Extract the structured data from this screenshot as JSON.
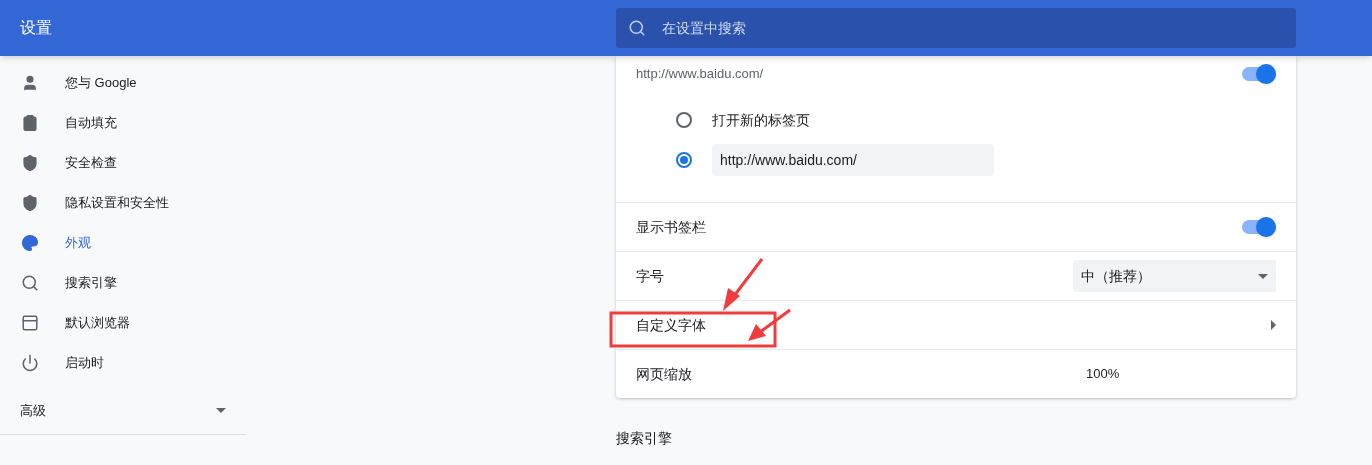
{
  "header": {
    "title": "设置",
    "search": {
      "placeholder": "在设置中搜索"
    }
  },
  "sidebar": {
    "items": [
      {
        "label": "您与 Google",
        "selected": false
      },
      {
        "label": "自动填充",
        "selected": false
      },
      {
        "label": "安全检查",
        "selected": false
      },
      {
        "label": "隐私设置和安全性",
        "selected": false
      },
      {
        "label": "外观",
        "selected": true
      },
      {
        "label": "搜索引擎",
        "selected": false
      },
      {
        "label": "默认浏览器",
        "selected": false
      },
      {
        "label": "启动时",
        "selected": false
      }
    ],
    "advanced": {
      "label": "高级",
      "expanded": false
    }
  },
  "appearance": {
    "home_button": {
      "subtitle": "http://www.baidu.com/",
      "on": true,
      "options": [
        {
          "kind": "label",
          "label": "打开新的标签页",
          "selected": false
        },
        {
          "kind": "field",
          "value": "http://www.baidu.com/",
          "selected": true
        }
      ]
    },
    "rows": [
      {
        "kind": "toggle",
        "label": "显示书签栏",
        "on": true
      },
      {
        "kind": "select",
        "label": "字号",
        "value": "中（推荐）"
      },
      {
        "kind": "link",
        "label": "自定义字体"
      },
      {
        "kind": "value",
        "label": "网页缩放",
        "value": "100%"
      }
    ]
  },
  "next_section": {
    "title": "搜索引擎"
  }
}
